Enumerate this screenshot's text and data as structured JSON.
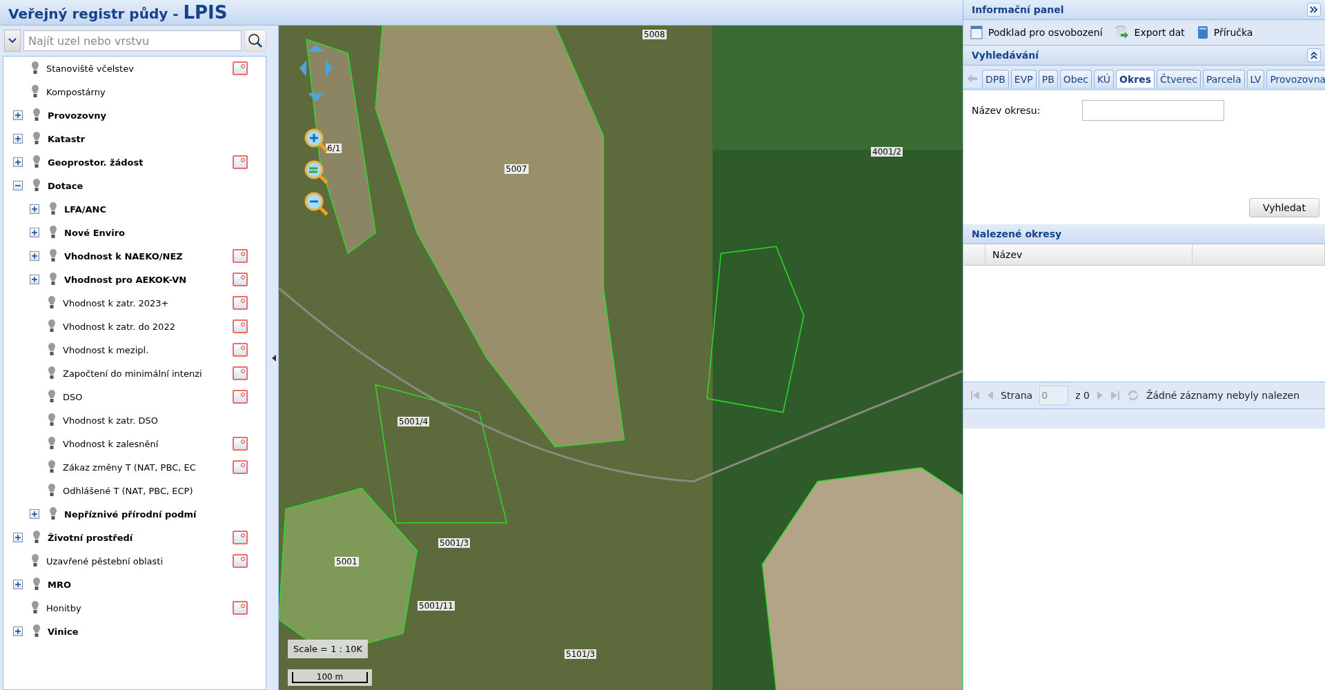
{
  "header": {
    "title": "Veřejný registr půdy - ",
    "acronym": "LPIS"
  },
  "layer_search": {
    "placeholder": "Najít uzel nebo vrstvu"
  },
  "layer_tree": [
    {
      "label": "Stanoviště včelstev",
      "kind": "layer",
      "legend": true
    },
    {
      "label": "Kompostárny",
      "kind": "layer",
      "legend": false
    },
    {
      "label": "Provozovny",
      "kind": "group",
      "expanded": false,
      "legend": false
    },
    {
      "label": "Katastr",
      "kind": "group",
      "expanded": false,
      "legend": false
    },
    {
      "label": "Geoprostor. žádost",
      "kind": "group",
      "expanded": false,
      "legend": true
    },
    {
      "label": "Dotace",
      "kind": "group",
      "expanded": true,
      "legend": false,
      "children": [
        {
          "label": "LFA/ANC",
          "kind": "group",
          "expanded": false,
          "legend": false
        },
        {
          "label": "Nové Enviro",
          "kind": "group",
          "expanded": false,
          "legend": false
        },
        {
          "label": "Vhodnost k NAEKO/NEZ",
          "kind": "group",
          "expanded": false,
          "legend": true
        },
        {
          "label": "Vhodnost pro AEKOK-VN",
          "kind": "group",
          "expanded": false,
          "legend": true
        },
        {
          "label": "Vhodnost k zatr. 2023+",
          "kind": "layer",
          "legend": true
        },
        {
          "label": "Vhodnost k zatr. do 2022",
          "kind": "layer",
          "legend": true
        },
        {
          "label": "Vhodnost k mezipl.",
          "kind": "layer",
          "legend": true
        },
        {
          "label": "Započtení do minimální intenzi",
          "kind": "layer",
          "legend": true
        },
        {
          "label": "DSO",
          "kind": "layer",
          "legend": true
        },
        {
          "label": "Vhodnost k zatr. DSO",
          "kind": "layer",
          "legend": false
        },
        {
          "label": "Vhodnost k zalesnění",
          "kind": "layer",
          "legend": true
        },
        {
          "label": "Zákaz změny T (NAT, PBC, EC",
          "kind": "layer",
          "legend": true
        },
        {
          "label": "Odhlášené T (NAT, PBC, ECP)",
          "kind": "layer",
          "legend": false
        },
        {
          "label": "Nepříznivé přírodní podmí",
          "kind": "group",
          "expanded": false,
          "legend": false
        }
      ]
    },
    {
      "label": "Životní prostředí",
      "kind": "group",
      "expanded": false,
      "legend": true
    },
    {
      "label": "Uzavřené pěstební oblasti",
      "kind": "layer",
      "legend": true
    },
    {
      "label": "MRO",
      "kind": "group",
      "expanded": false,
      "legend": false
    },
    {
      "label": "Honitby",
      "kind": "layer",
      "legend": true
    },
    {
      "label": "Vinice",
      "kind": "group",
      "expanded": false,
      "legend": false
    }
  ],
  "map": {
    "parcel_labels": [
      "5008",
      "6/1",
      "4001/2",
      "5007",
      "5001/4",
      "5001/3",
      "5001",
      "5001/11",
      "5101/3"
    ],
    "scale": "Scale = 1 : 10K",
    "scale_bar": "100 m"
  },
  "info_panel": {
    "title": "Informační panel",
    "toolbar": [
      "Podklad pro osvobození",
      "Export dat",
      "Příručka"
    ],
    "search": {
      "title": "Vyhledávání",
      "tabs": [
        {
          "label": "DPB",
          "selected": false
        },
        {
          "label": "EVP",
          "selected": false
        },
        {
          "label": "PB",
          "selected": false
        },
        {
          "label": "Obec",
          "selected": false
        },
        {
          "label": "KÚ",
          "selected": false
        },
        {
          "label": "Okres",
          "selected": true
        },
        {
          "label": "Čtverec",
          "selected": false
        },
        {
          "label": "Parcela",
          "selected": false
        },
        {
          "label": "LV",
          "selected": false
        },
        {
          "label": "Provozovna",
          "selected": false
        }
      ],
      "field_label": "Název okresu:",
      "button": "Vyhledat"
    },
    "results": {
      "title": "Nalezené okresy",
      "columns": [
        "Název"
      ],
      "pager": {
        "page_label": "Strana",
        "page_value": "0",
        "of": "z 0",
        "status": "Žádné záznamy nebyly nalezen"
      }
    }
  }
}
